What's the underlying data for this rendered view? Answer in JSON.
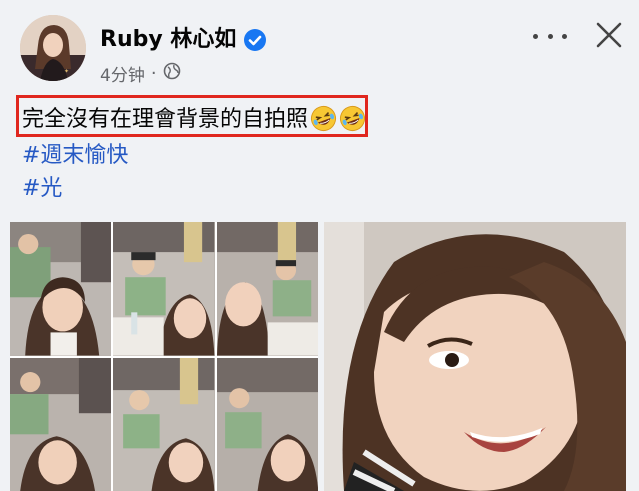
{
  "post": {
    "author": {
      "name": "Ruby 林心如",
      "verified_icon": "verified-badge-icon",
      "time": "4分钟",
      "separator": "·",
      "audience_icon": "globe-icon"
    },
    "actions": {
      "more_icon": "more-options-icon",
      "close_icon": "close-icon"
    },
    "text": "完全沒有在理會背景的自拍照",
    "emojis": [
      "rolling-on-floor-laughing-emoji",
      "rolling-on-floor-laughing-emoji"
    ],
    "hashtags": [
      "#週末愉快",
      "#光"
    ],
    "highlight_color": "#e0271f",
    "link_color": "#2659c4",
    "photos": {
      "grid_tiles": 6,
      "large_photo": "selfie-closeup"
    }
  }
}
